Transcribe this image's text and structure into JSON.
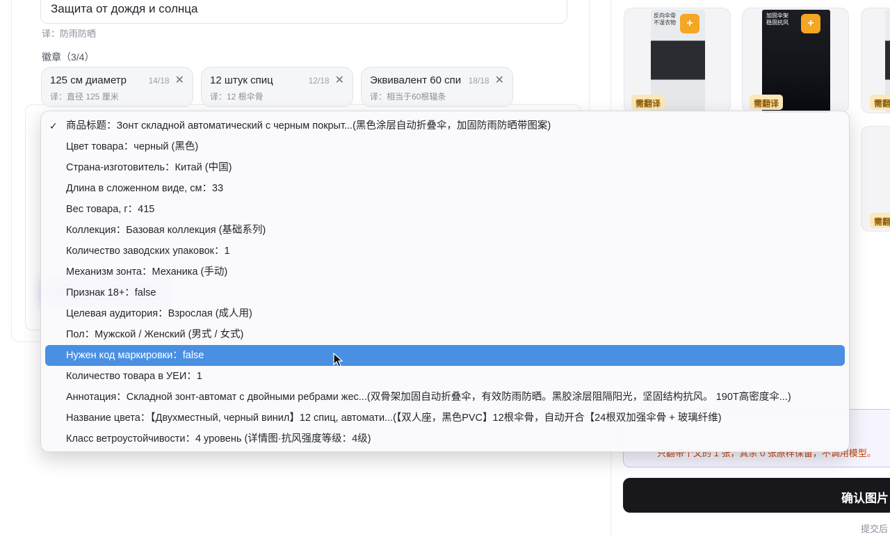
{
  "editor": {
    "title_value": "Защита от дождя и солнца",
    "title_translation": "译：防雨防晒",
    "badges_label": "徽章（3/4）",
    "chips": [
      {
        "text": "125 см диаметр",
        "count": "14/18",
        "translation": "译：直径 125 厘米"
      },
      {
        "text": "12 штук спиц",
        "count": "12/18",
        "translation": "译：12 根伞骨"
      },
      {
        "text": "Эквивалент 60 спи",
        "count": "18/18",
        "translation": "译：相当于60根辐条"
      }
    ]
  },
  "dropdown": {
    "items": [
      {
        "label": "商品标题：Зонт складной автоматический с черным покрыт...(黑色涂层自动折叠伞，加固防雨防晒带图案)",
        "checked": true
      },
      {
        "label": "Цвет товара：черный (黑色)"
      },
      {
        "label": "Страна-изготовитель：Китай (中国)"
      },
      {
        "label": "Длина в сложенном виде, см：33"
      },
      {
        "label": "Вес товара, г：415"
      },
      {
        "label": "Коллекция：Базовая коллекция (基础系列)"
      },
      {
        "label": "Количество заводских упаковок：1"
      },
      {
        "label": "Механизм зонта：Механика (手动)"
      },
      {
        "label": "Признак 18+：false"
      },
      {
        "label": "Целевая аудитория：Взрослая (成人用)"
      },
      {
        "label": "Пол：Мужской / Женский (男式 / 女式)"
      },
      {
        "label": "Нужен код маркировки：false",
        "selected": true
      },
      {
        "label": "Количество товара в УЕИ：1"
      },
      {
        "label": "Аннотация：Складной зонт-автомат с двойными ребрами жес...(双骨架加固自动折叠伞，有效防雨防晒。黑胶涂层阻隔阳光，坚固结构抗风。 190T高密度伞...)"
      },
      {
        "label": "Название цвета：【Двухместный, черный винил】12 спиц, автомати...(【双人座，黑色PVC】12根伞骨，自动开合【24根双加强伞骨 + 玻璃纤维)"
      },
      {
        "label": "Класс ветроустойчивости：4 уровень (详情图·抗风强度等级：4级)"
      }
    ],
    "check_glyph": "✓",
    "selected_color": "#4a90e2"
  },
  "gallery": {
    "thumbs": [
      {
        "caption": "反向伞骨\n不湿衣物",
        "badge": "需翻译",
        "plus": "+"
      },
      {
        "caption": "加固伞架\n稳固抗风",
        "badge": "需翻译",
        "plus": "+"
      },
      {
        "badge": "需翻"
      }
    ],
    "row2_badge": "需翻"
  },
  "notice": {
    "text": "只翻带个文的 1 张，其余 0 张原样保留，不调用模型。"
  },
  "actions": {
    "confirm_label": "确认图片",
    "submit_hint": "提交后"
  },
  "colors": {
    "accent": "#4a90e2",
    "badge_bg": "#fde7b8",
    "plus_orange": "#f5a623",
    "confirm_bg": "#17171c"
  }
}
